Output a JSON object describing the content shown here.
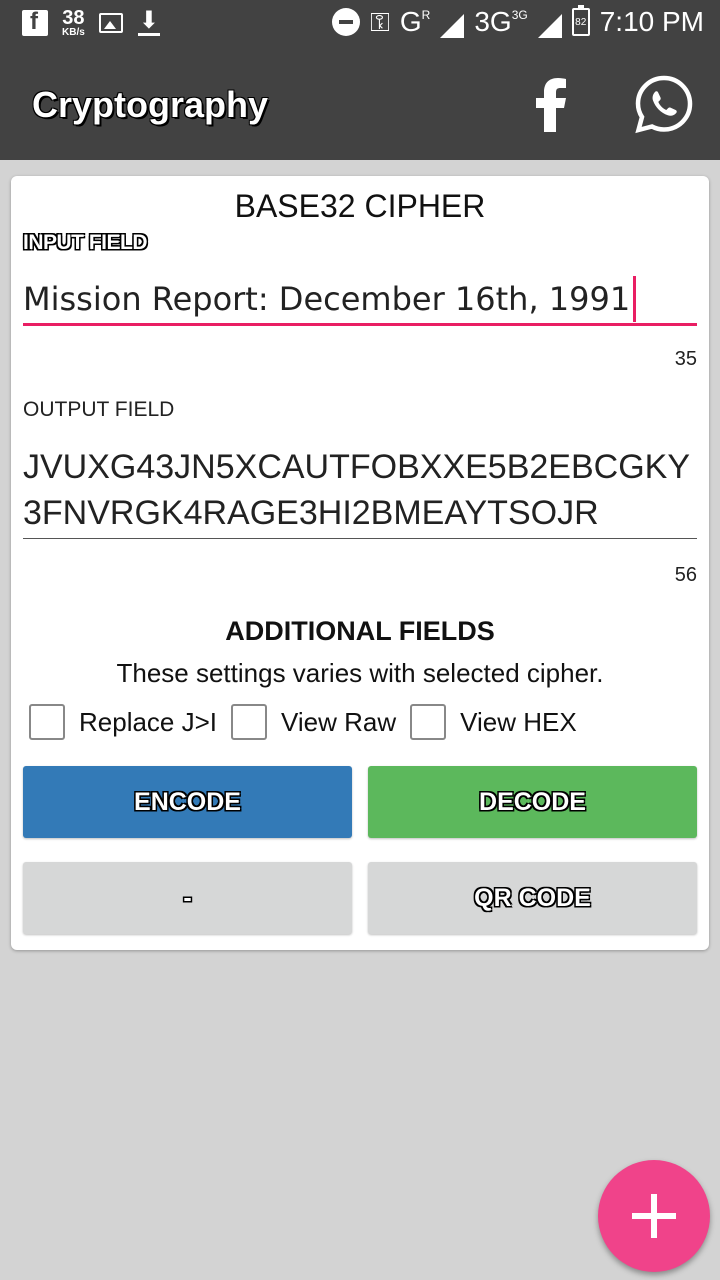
{
  "status_bar": {
    "net_speed": "38",
    "net_unit": "KB/s",
    "network_1": "G",
    "network_1_sup": "R",
    "network_2": "3G",
    "network_2_sup": "3G",
    "battery": "82",
    "time": "7:10 PM",
    "icons": [
      "facebook-icon",
      "image-icon",
      "download-icon",
      "do-not-disturb-icon",
      "vpn-key-icon",
      "signal-icon",
      "battery-icon"
    ]
  },
  "app_bar": {
    "title": "Cryptography",
    "icons": [
      "facebook-icon",
      "whatsapp-icon"
    ],
    "background": "#424242"
  },
  "card": {
    "title": "BASE32 CIPHER",
    "input_label": "INPUT FIELD",
    "input_value": "Mission Report: December 16th, 1991",
    "input_count": "35",
    "output_label": "OUTPUT FIELD",
    "output_value": "JVUXG43JN5XCAUTFOBXXE5B2EBCGKY3FNVRGK4RAGE3HI2BMEAYTSOJR",
    "output_count": "56",
    "additional_title": "ADDITIONAL FIELDS",
    "additional_subtitle": "These settings varies with selected cipher.",
    "checkboxes": [
      {
        "label": "Replace J>I",
        "checked": false
      },
      {
        "label": "View Raw",
        "checked": false
      },
      {
        "label": "View HEX",
        "checked": false
      }
    ],
    "buttons": {
      "encode": "ENCODE",
      "decode": "DECODE",
      "dash": "-",
      "qr": "QR CODE"
    }
  },
  "colors": {
    "accent": "#e91e63",
    "encode": "#337ab7",
    "decode": "#5cb85c",
    "secondary_button": "#d6d7d7",
    "fab": "#f0438a"
  },
  "fab": {
    "icon": "plus-icon"
  }
}
